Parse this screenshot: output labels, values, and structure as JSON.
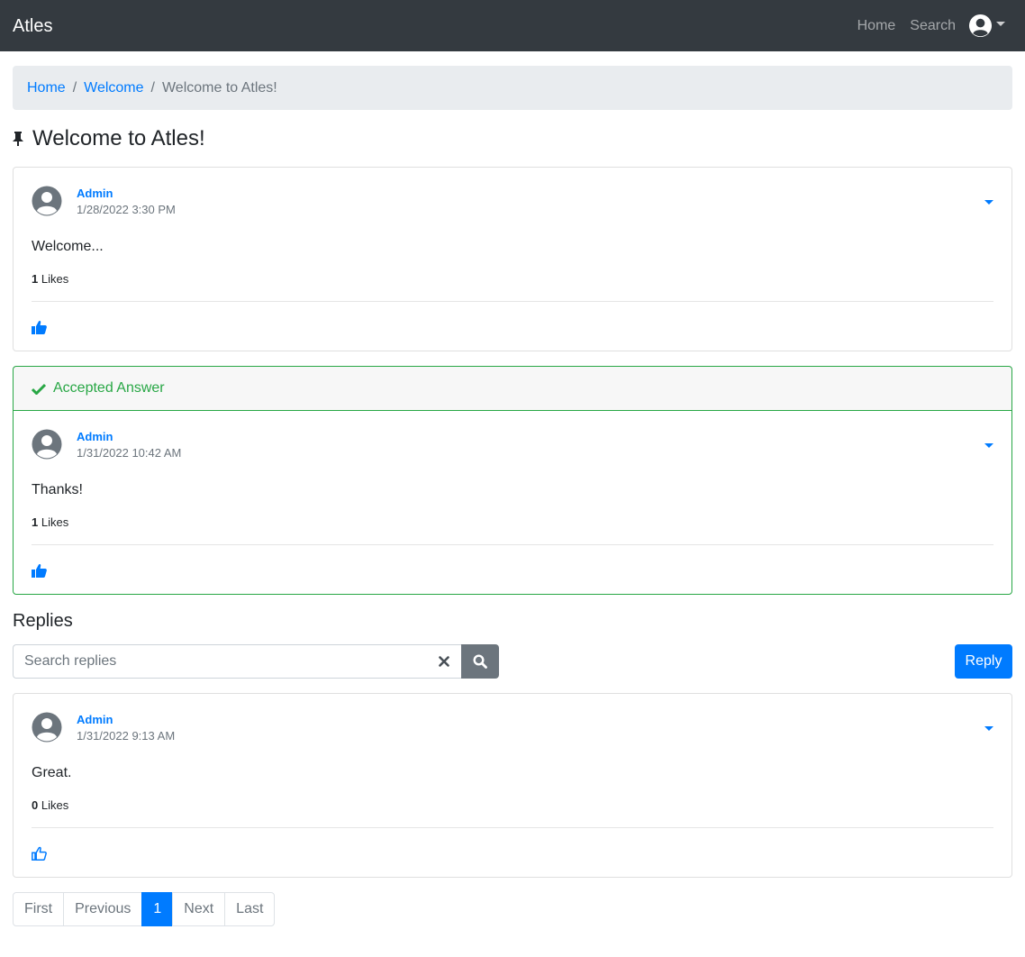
{
  "navbar": {
    "brand": "Atles",
    "links": [
      "Home",
      "Search"
    ],
    "user_icon": "user-circle-icon"
  },
  "breadcrumb": {
    "items": [
      "Home",
      "Welcome"
    ],
    "active": "Welcome to Atles!"
  },
  "topic": {
    "icon": "pin-icon",
    "title": "Welcome to Atles!"
  },
  "first_post": {
    "author": "Admin",
    "timestamp": "1/28/2022 3:30 PM",
    "text": "Welcome...",
    "likes_count": "1",
    "likes_label": "Likes",
    "liked": true
  },
  "accepted_answer": {
    "header": "Accepted Answer",
    "author": "Admin",
    "timestamp": "1/31/2022 10:42 AM",
    "text": "Thanks!",
    "likes_count": "1",
    "likes_label": "Likes",
    "liked": true
  },
  "replies": {
    "title": "Replies",
    "search_placeholder": "Search replies",
    "reply_button": "Reply",
    "items": [
      {
        "author": "Admin",
        "timestamp": "1/31/2022 9:13 AM",
        "text": "Great.",
        "likes_count": "0",
        "likes_label": "Likes",
        "liked": false
      }
    ]
  },
  "pagination": {
    "first": "First",
    "previous": "Previous",
    "current": "1",
    "next": "Next",
    "last": "Last"
  },
  "colors": {
    "navbar": "#343a40",
    "primary": "#007bff",
    "success": "#28a745",
    "secondary": "#6c757d"
  }
}
